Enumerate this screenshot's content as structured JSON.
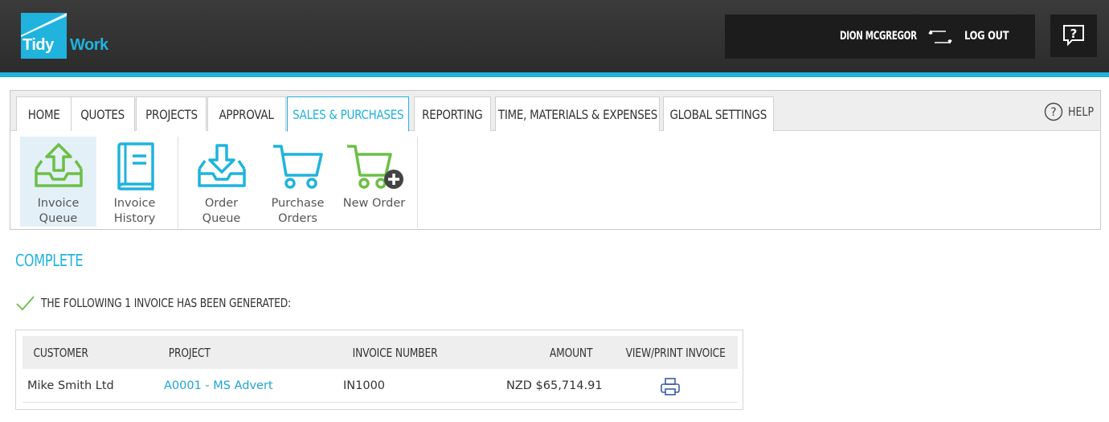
{
  "brand": {
    "logo_word1": "Tidy",
    "logo_word2": "Work",
    "accent": "#1fb3de"
  },
  "header": {
    "user_name": "DION MCGREGOR",
    "logout_label": "LOG OUT"
  },
  "nav": {
    "tabs": [
      {
        "label": "HOME"
      },
      {
        "label": "QUOTES"
      },
      {
        "label": "PROJECTS"
      },
      {
        "label": "APPROVAL"
      },
      {
        "label": "SALES & PURCHASES",
        "active": true
      },
      {
        "label": "REPORTING"
      },
      {
        "label": "TIME, MATERIALS & EXPENSES"
      },
      {
        "label": "GLOBAL SETTINGS"
      }
    ],
    "help_label": "HELP"
  },
  "ribbon": {
    "items": [
      {
        "line1": "Invoice",
        "line2": "Queue",
        "icon": "inbox-upload-icon",
        "selected": true
      },
      {
        "line1": "Invoice",
        "line2": "History",
        "icon": "book-icon"
      },
      {
        "line1": "Order",
        "line2": "Queue",
        "icon": "inbox-download-icon"
      },
      {
        "line1": "Purchase",
        "line2": "Orders",
        "icon": "cart-icon"
      },
      {
        "line1": "New Order",
        "line2": "",
        "icon": "cart-add-icon"
      }
    ]
  },
  "content": {
    "title": "COMPLETE",
    "message": "THE FOLLOWING 1 INVOICE HAS BEEN GENERATED:",
    "table": {
      "headers": [
        "CUSTOMER",
        "PROJECT",
        "INVOICE NUMBER",
        "AMOUNT",
        "VIEW/PRINT INVOICE"
      ],
      "rows": [
        {
          "customer": "Mike Smith Ltd",
          "project": "A0001 - MS Advert",
          "invoice_number": "IN1000",
          "amount": "NZD $65,714.91"
        }
      ]
    }
  }
}
